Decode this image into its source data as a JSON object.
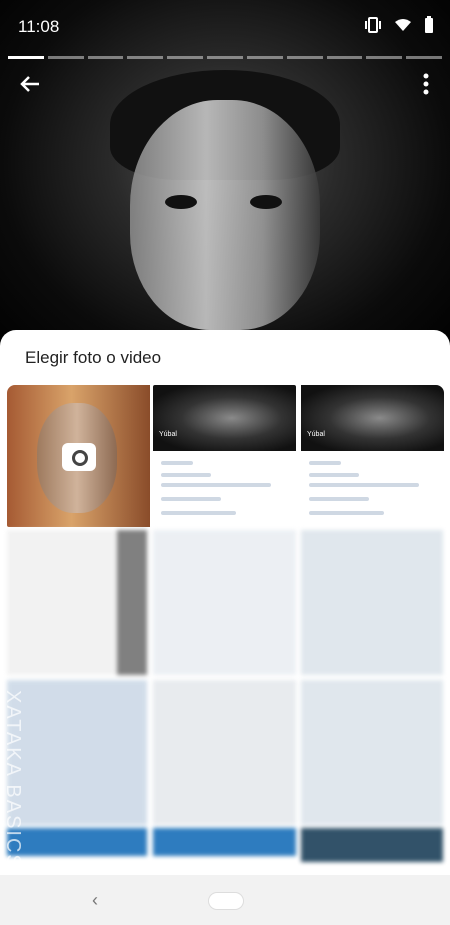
{
  "status_bar": {
    "time": "11:08",
    "icons": [
      "vibrate-icon",
      "wifi-icon",
      "battery-icon"
    ]
  },
  "story": {
    "progress_segments": 11,
    "current_segment": 1
  },
  "toolbar": {
    "back_icon": "arrow-left-icon",
    "more_icon": "more-vertical-icon"
  },
  "picker": {
    "title": "Elegir foto o video",
    "camera_tile_icon": "camera-icon",
    "profile_previews": [
      {
        "name": "Yúbal"
      },
      {
        "name": "Yúbal"
      }
    ]
  },
  "watermark": "XATAKA BASICS",
  "nav": {
    "back_icon": "back-icon",
    "home_icon": "home-pill-icon"
  }
}
